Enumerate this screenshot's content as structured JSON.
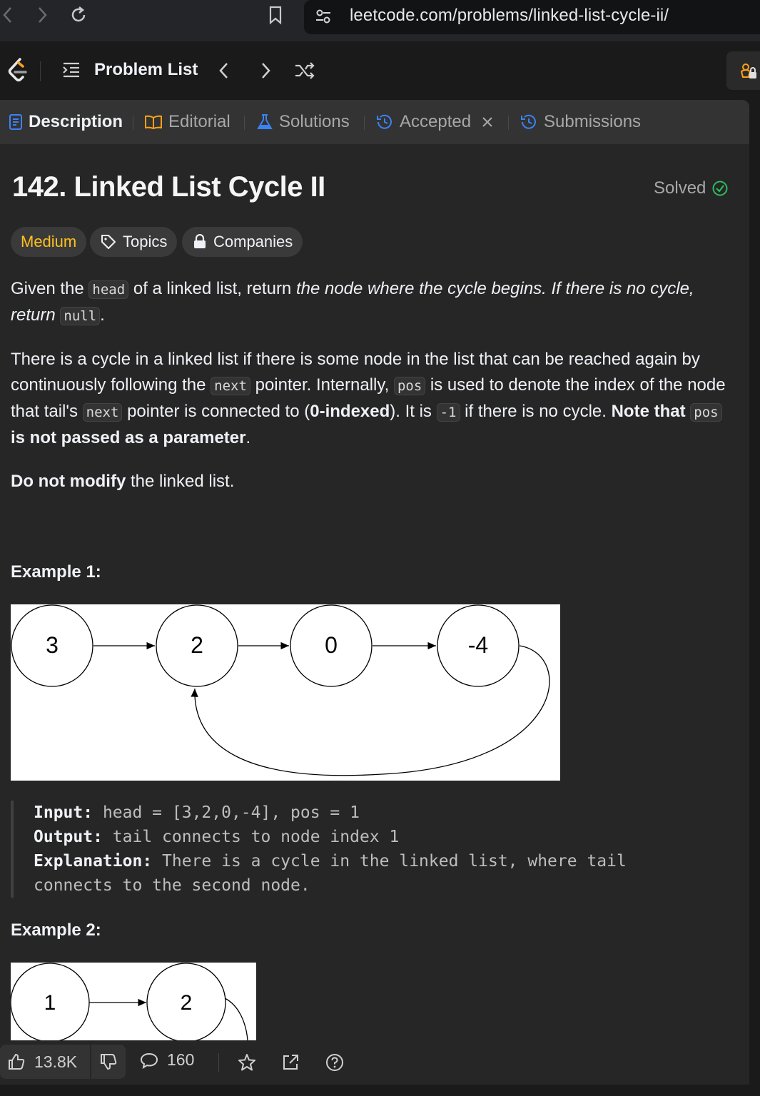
{
  "browser": {
    "url": "leetcode.com/problems/linked-list-cycle-ii/"
  },
  "header": {
    "problem_list_label": "Problem List"
  },
  "tabs": [
    {
      "label": "Description",
      "icon": "description-icon",
      "active": true
    },
    {
      "label": "Editorial",
      "icon": "book-icon"
    },
    {
      "label": "Solutions",
      "icon": "flask-icon"
    },
    {
      "label": "Accepted",
      "icon": "history-icon",
      "closable": true
    },
    {
      "label": "Submissions",
      "icon": "history-icon"
    }
  ],
  "problem": {
    "title": "142. Linked List Cycle II",
    "status": "Solved",
    "difficulty": "Medium",
    "topics_label": "Topics",
    "companies_label": "Companies"
  },
  "description": {
    "p1_a": "Given the ",
    "p1_code1": "head",
    "p1_b": " of a linked list, return ",
    "p1_em": "the node where the cycle begins. If there is no cycle, return ",
    "p1_code2": "null",
    "p1_c": ".",
    "p2_a": "There is a cycle in a linked list if there is some node in the list that can be reached again by continuously following the ",
    "p2_code1": "next",
    "p2_b": " pointer. Internally, ",
    "p2_code2": "pos",
    "p2_c": " is used to denote the index of the node that tail's ",
    "p2_code3": "next",
    "p2_d": " pointer is connected to (",
    "p2_bold1": "0-indexed",
    "p2_e": "). It is ",
    "p2_code4": "-1",
    "p2_f": " if there is no cycle. ",
    "p2_bold2": "Note that ",
    "p2_code5": "pos",
    "p2_bold3": " is not passed as a parameter",
    "p2_g": ".",
    "p3_bold": "Do not modify",
    "p3_rest": " the linked list."
  },
  "example1": {
    "title": "Example 1:",
    "nodes": [
      "3",
      "2",
      "0",
      "-4"
    ],
    "input_label": "Input:",
    "input": " head = [3,2,0,-4], pos = 1",
    "output_label": "Output:",
    "output": " tail connects to node index 1",
    "explanation_label": "Explanation:",
    "explanation_1": " There is a cycle in the linked list, where tail",
    "explanation_2": "connects to the second node."
  },
  "example2": {
    "title": "Example 2:",
    "nodes": [
      "1",
      "2"
    ]
  },
  "bottom_bar": {
    "likes": "13.8K",
    "comments": "160"
  }
}
